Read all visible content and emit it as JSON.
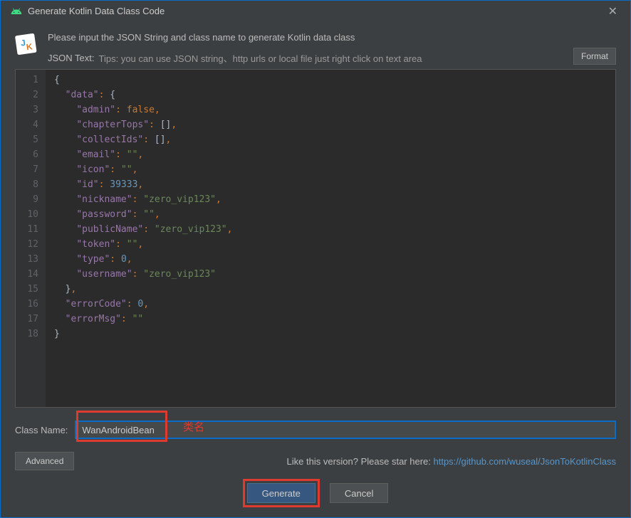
{
  "window": {
    "title": "Generate Kotlin Data Class Code"
  },
  "header": {
    "instruction": "Please input the JSON String and class name to generate Kotlin data class",
    "json_label": "JSON Text:",
    "json_tips": "Tips: you can use JSON string、http urls or local file just right click on text area",
    "format_btn": "Format"
  },
  "editor": {
    "lines": [
      [
        [
          "brace",
          "{"
        ]
      ],
      [
        [
          "indent",
          "  "
        ],
        [
          "key",
          "\"data\""
        ],
        [
          "colon",
          ": "
        ],
        [
          "brace",
          "{"
        ]
      ],
      [
        [
          "indent",
          "    "
        ],
        [
          "key",
          "\"admin\""
        ],
        [
          "colon",
          ": "
        ],
        [
          "bool",
          "false"
        ],
        [
          "comma",
          ","
        ]
      ],
      [
        [
          "indent",
          "    "
        ],
        [
          "key",
          "\"chapterTops\""
        ],
        [
          "colon",
          ": "
        ],
        [
          "bracket",
          "[]"
        ],
        [
          "comma",
          ","
        ]
      ],
      [
        [
          "indent",
          "    "
        ],
        [
          "key",
          "\"collectIds\""
        ],
        [
          "colon",
          ": "
        ],
        [
          "bracket",
          "[]"
        ],
        [
          "comma",
          ","
        ]
      ],
      [
        [
          "indent",
          "    "
        ],
        [
          "key",
          "\"email\""
        ],
        [
          "colon",
          ": "
        ],
        [
          "string",
          "\"\""
        ],
        [
          "comma",
          ","
        ]
      ],
      [
        [
          "indent",
          "    "
        ],
        [
          "key",
          "\"icon\""
        ],
        [
          "colon",
          ": "
        ],
        [
          "string",
          "\"\""
        ],
        [
          "comma",
          ","
        ]
      ],
      [
        [
          "indent",
          "    "
        ],
        [
          "key",
          "\"id\""
        ],
        [
          "colon",
          ": "
        ],
        [
          "number",
          "39333"
        ],
        [
          "comma",
          ","
        ]
      ],
      [
        [
          "indent",
          "    "
        ],
        [
          "key",
          "\"nickname\""
        ],
        [
          "colon",
          ": "
        ],
        [
          "string",
          "\"zero_vip123\""
        ],
        [
          "comma",
          ","
        ]
      ],
      [
        [
          "indent",
          "    "
        ],
        [
          "key",
          "\"password\""
        ],
        [
          "colon",
          ": "
        ],
        [
          "string",
          "\"\""
        ],
        [
          "comma",
          ","
        ]
      ],
      [
        [
          "indent",
          "    "
        ],
        [
          "key",
          "\"publicName\""
        ],
        [
          "colon",
          ": "
        ],
        [
          "string",
          "\"zero_vip123\""
        ],
        [
          "comma",
          ","
        ]
      ],
      [
        [
          "indent",
          "    "
        ],
        [
          "key",
          "\"token\""
        ],
        [
          "colon",
          ": "
        ],
        [
          "string",
          "\"\""
        ],
        [
          "comma",
          ","
        ]
      ],
      [
        [
          "indent",
          "    "
        ],
        [
          "key",
          "\"type\""
        ],
        [
          "colon",
          ": "
        ],
        [
          "number",
          "0"
        ],
        [
          "comma",
          ","
        ]
      ],
      [
        [
          "indent",
          "    "
        ],
        [
          "key",
          "\"username\""
        ],
        [
          "colon",
          ": "
        ],
        [
          "string",
          "\"zero_vip123\""
        ]
      ],
      [
        [
          "indent",
          "  "
        ],
        [
          "brace",
          "}"
        ],
        [
          "comma",
          ","
        ]
      ],
      [
        [
          "indent",
          "  "
        ],
        [
          "key",
          "\"errorCode\""
        ],
        [
          "colon",
          ": "
        ],
        [
          "number",
          "0"
        ],
        [
          "comma",
          ","
        ]
      ],
      [
        [
          "indent",
          "  "
        ],
        [
          "key",
          "\"errorMsg\""
        ],
        [
          "colon",
          ": "
        ],
        [
          "string",
          "\"\""
        ]
      ],
      [
        [
          "brace",
          "}"
        ]
      ]
    ]
  },
  "class_name": {
    "label": "Class Name:",
    "value": "WanAndroidBean",
    "annotation": "类名"
  },
  "footer": {
    "advanced": "Advanced",
    "star_text": "Like this version? Please star here: ",
    "star_link": "https://github.com/wuseal/JsonToKotlinClass",
    "generate": "Generate",
    "cancel": "Cancel"
  }
}
